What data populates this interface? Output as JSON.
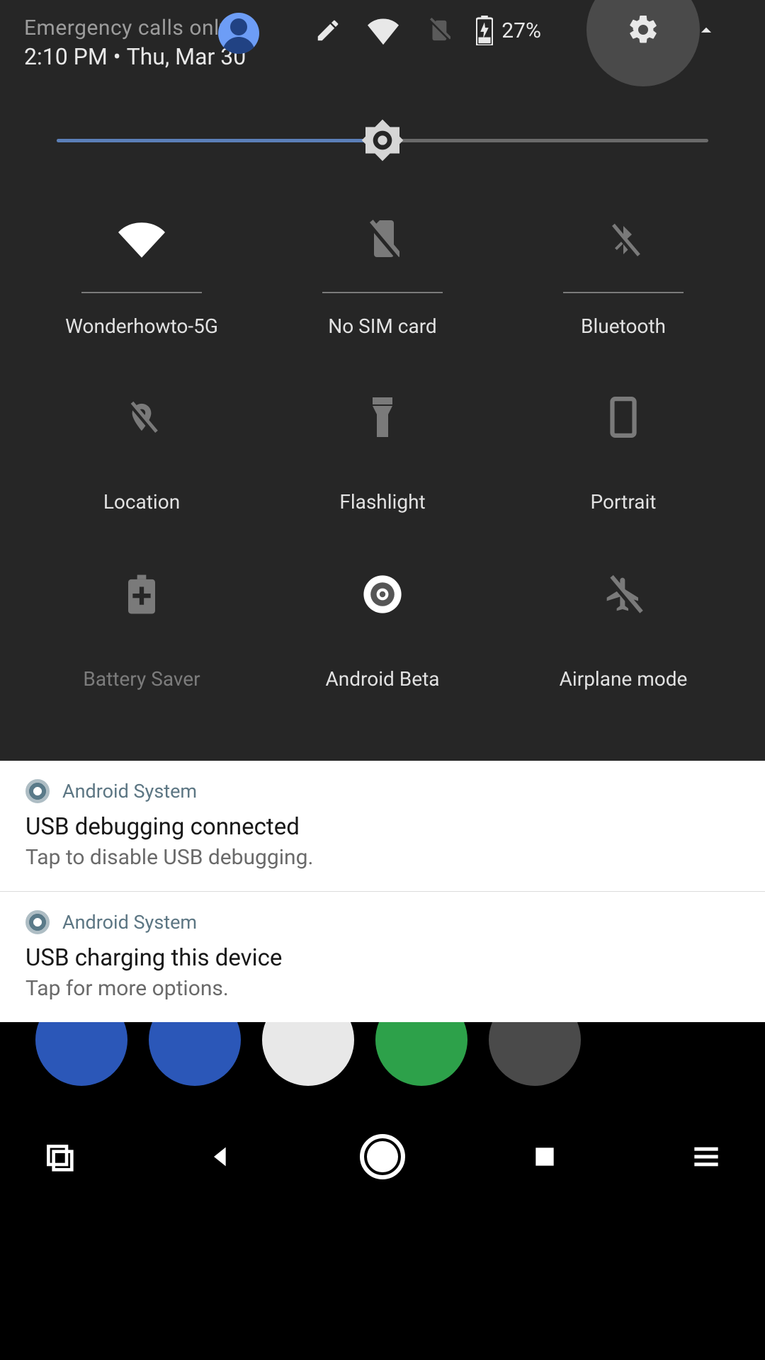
{
  "header": {
    "status": "Emergency calls only",
    "time": "2:10 PM",
    "date": "Thu, Mar 30",
    "battery_pct": "27%"
  },
  "brightness": {
    "percent": 50
  },
  "tiles": [
    {
      "label": "Wonderhowto-5G",
      "icon": "wifi",
      "active": true,
      "bar": true
    },
    {
      "label": "No SIM card",
      "icon": "sim-off",
      "active": false,
      "bar": true
    },
    {
      "label": "Bluetooth",
      "icon": "bluetooth-off",
      "active": false,
      "bar": true
    },
    {
      "label": "Location",
      "icon": "location-off",
      "active": false,
      "bar": false
    },
    {
      "label": "Flashlight",
      "icon": "flashlight",
      "active": false,
      "bar": false
    },
    {
      "label": "Portrait",
      "icon": "portrait",
      "active": false,
      "bar": false
    },
    {
      "label": "Battery Saver",
      "icon": "battery-saver",
      "active": false,
      "bar": false,
      "disabled": true
    },
    {
      "label": "Android Beta",
      "icon": "android-beta",
      "active": true,
      "bar": false
    },
    {
      "label": "Airplane mode",
      "icon": "airplane-off",
      "active": false,
      "bar": false
    }
  ],
  "notifications": [
    {
      "app": "Android System",
      "title": "USB debugging connected",
      "subtitle": "Tap to disable USB debugging."
    },
    {
      "app": "Android System",
      "title": "USB charging this device",
      "subtitle": "Tap for more options."
    }
  ]
}
